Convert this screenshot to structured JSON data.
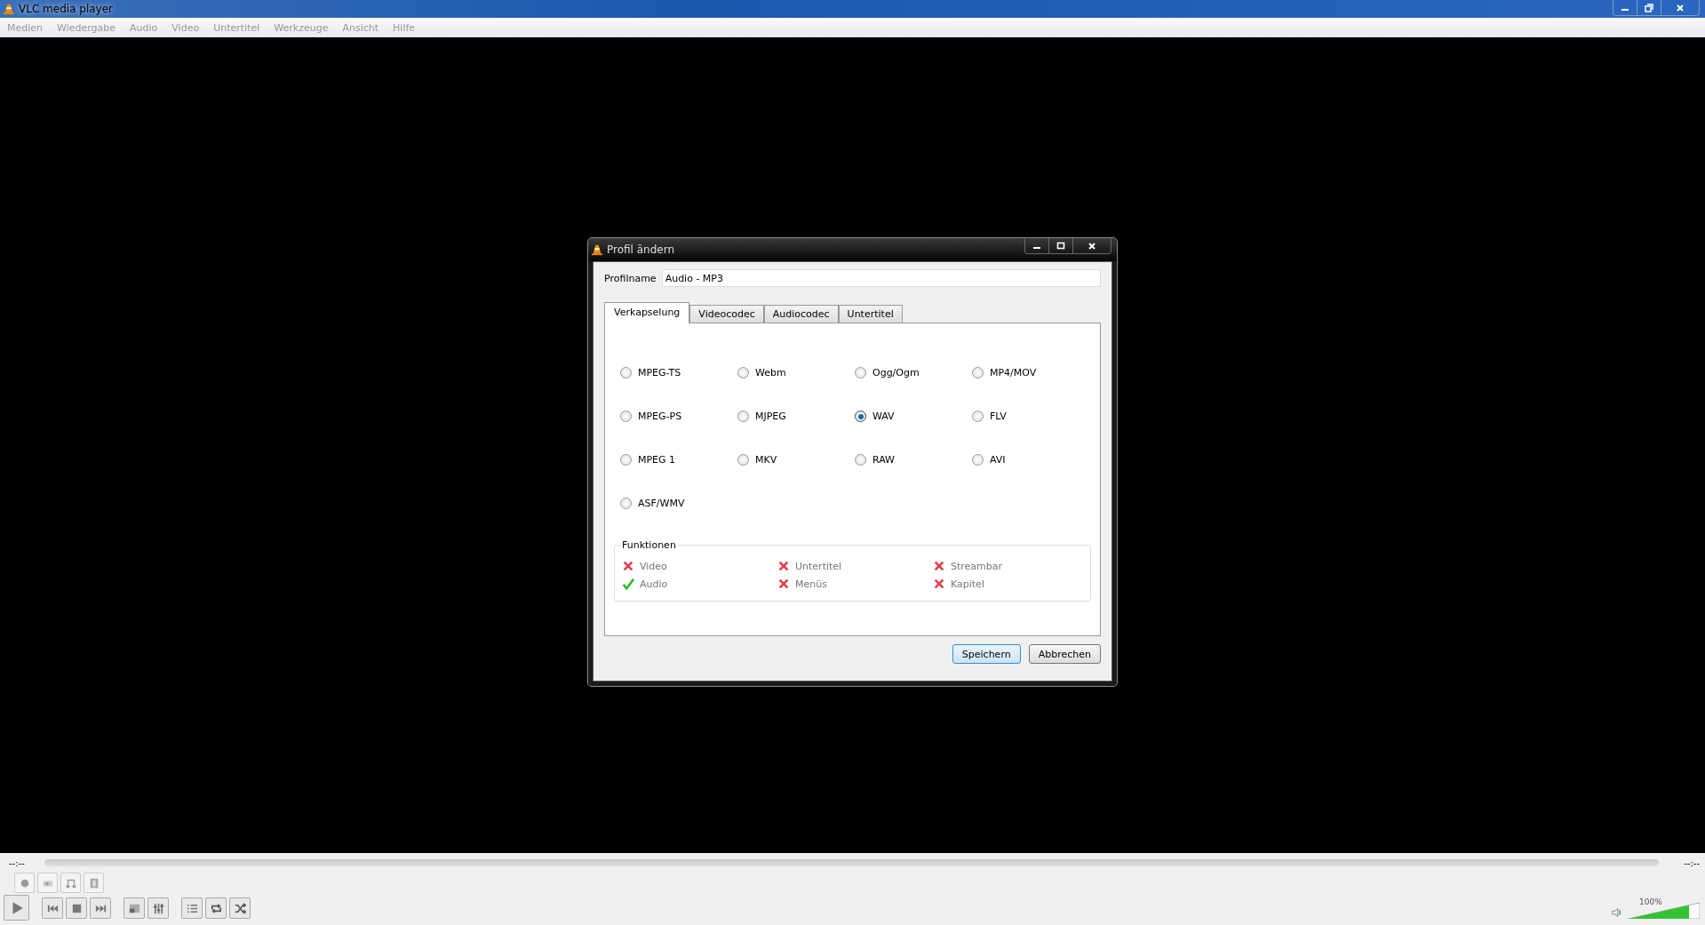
{
  "window": {
    "title": "VLC media player"
  },
  "menu": [
    "Medien",
    "Wiedergabe",
    "Audio",
    "Video",
    "Untertitel",
    "Werkzeuge",
    "Ansicht",
    "Hilfe"
  ],
  "dialog": {
    "title": "Profil ändern",
    "profile_label": "Profilname",
    "profile_value": "Audio - MP3",
    "tabs": [
      {
        "label": "Verkapselung",
        "selected": true
      },
      {
        "label": "Videocodec",
        "selected": false
      },
      {
        "label": "Audiocodec",
        "selected": false
      },
      {
        "label": "Untertitel",
        "selected": false
      }
    ],
    "formats": [
      {
        "label": "MPEG-TS",
        "selected": false
      },
      {
        "label": "Webm",
        "selected": false
      },
      {
        "label": "Ogg/Ogm",
        "selected": false
      },
      {
        "label": "MP4/MOV",
        "selected": false
      },
      {
        "label": "MPEG-PS",
        "selected": false
      },
      {
        "label": "MJPEG",
        "selected": false
      },
      {
        "label": "WAV",
        "selected": true
      },
      {
        "label": "FLV",
        "selected": false
      },
      {
        "label": "MPEG 1",
        "selected": false
      },
      {
        "label": "MKV",
        "selected": false
      },
      {
        "label": "RAW",
        "selected": false
      },
      {
        "label": "AVI",
        "selected": false
      },
      {
        "label": "ASF/WMV",
        "selected": false
      }
    ],
    "features_title": "Funktionen",
    "features": [
      {
        "label": "Video",
        "checked": false
      },
      {
        "label": "Untertitel",
        "checked": false
      },
      {
        "label": "Streambar",
        "checked": false
      },
      {
        "label": "Audio",
        "checked": true
      },
      {
        "label": "Menüs",
        "checked": false
      },
      {
        "label": "Kapitel",
        "checked": false
      }
    ],
    "buttons": [
      "Speichern",
      "Abbrechen"
    ]
  },
  "player": {
    "elapsed": "--:--",
    "remaining": "--:--",
    "volume": {
      "reading": "100%",
      "level": 0.85
    }
  }
}
